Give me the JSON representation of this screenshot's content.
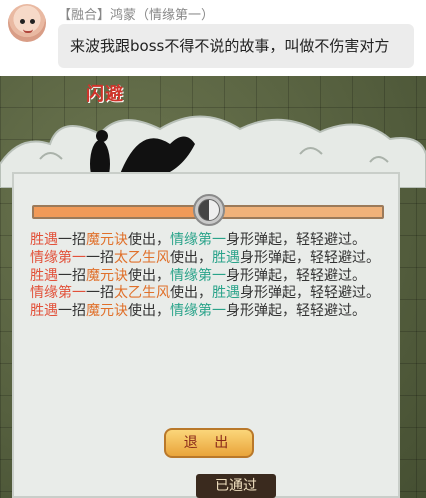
{
  "chat": {
    "sender": "【融合】鸿蒙（情缘第一）",
    "message": "来波我跟boss不得不说的故事，叫做不伤害对方"
  },
  "battle": {
    "title": "闪避",
    "progress": 0.5,
    "exit_label": "退 出",
    "bottom_sign": "已通过",
    "log": [
      {
        "actor": "胜遇",
        "mid": "一招",
        "skill": "魔元诀",
        "use": "使出，",
        "target": "情缘第一",
        "tail": "身形弹起，轻轻避过。"
      },
      {
        "actor": "情缘第一",
        "mid": "一招",
        "skill": "太乙生风",
        "use": "使出，",
        "target": "胜遇",
        "tail": "身形弹起，轻轻避过。"
      },
      {
        "actor": "胜遇",
        "mid": "一招",
        "skill": "魔元诀",
        "use": "使出，",
        "target": "情缘第一",
        "tail": "身形弹起，轻轻避过。"
      },
      {
        "actor": "情缘第一",
        "mid": "一招",
        "skill": "太乙生风",
        "use": "使出，",
        "target": "胜遇",
        "tail": "身形弹起，轻轻避过。"
      },
      {
        "actor": "胜遇",
        "mid": "一招",
        "skill": "魔元诀",
        "use": "使出，",
        "target": "情缘第一",
        "tail": "身形弹起，轻轻避过。"
      }
    ]
  },
  "colors": {
    "actor": "#e2513a",
    "target": "#2aa38a",
    "skill": "#e0702a"
  }
}
